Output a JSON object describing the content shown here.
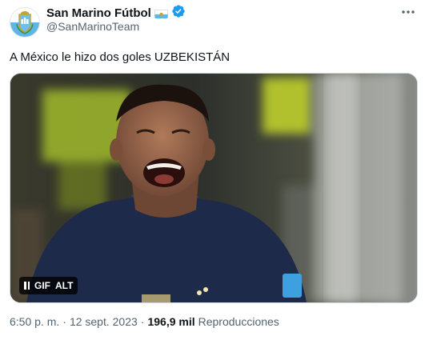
{
  "author": {
    "display_name": "San Marino Fútbol",
    "handle": "@SanMarinoTeam",
    "flag_emoji": "flag-san-marino",
    "verified_icon": "verified-badge-icon",
    "avatar_icon": "san-marino-crest"
  },
  "menu_icon": "more-options-icon",
  "tweet": {
    "text": "A México le hizo dos goles UZBEKISTÁN"
  },
  "media": {
    "type": "gif",
    "gif_label": "GIF",
    "alt_label": "ALT",
    "pause_icon": "pause-icon"
  },
  "meta": {
    "time": "6:50 p. m.",
    "separator_1": "·",
    "date": "12 sept. 2023",
    "separator_2": "·",
    "view_count": "196,9 mil",
    "view_label": "Reproducciones"
  },
  "colors": {
    "verified": "#1d9bf0",
    "secondary_text": "#536471",
    "primary_text": "#0f1419",
    "jersey": "#1d2a4a"
  }
}
